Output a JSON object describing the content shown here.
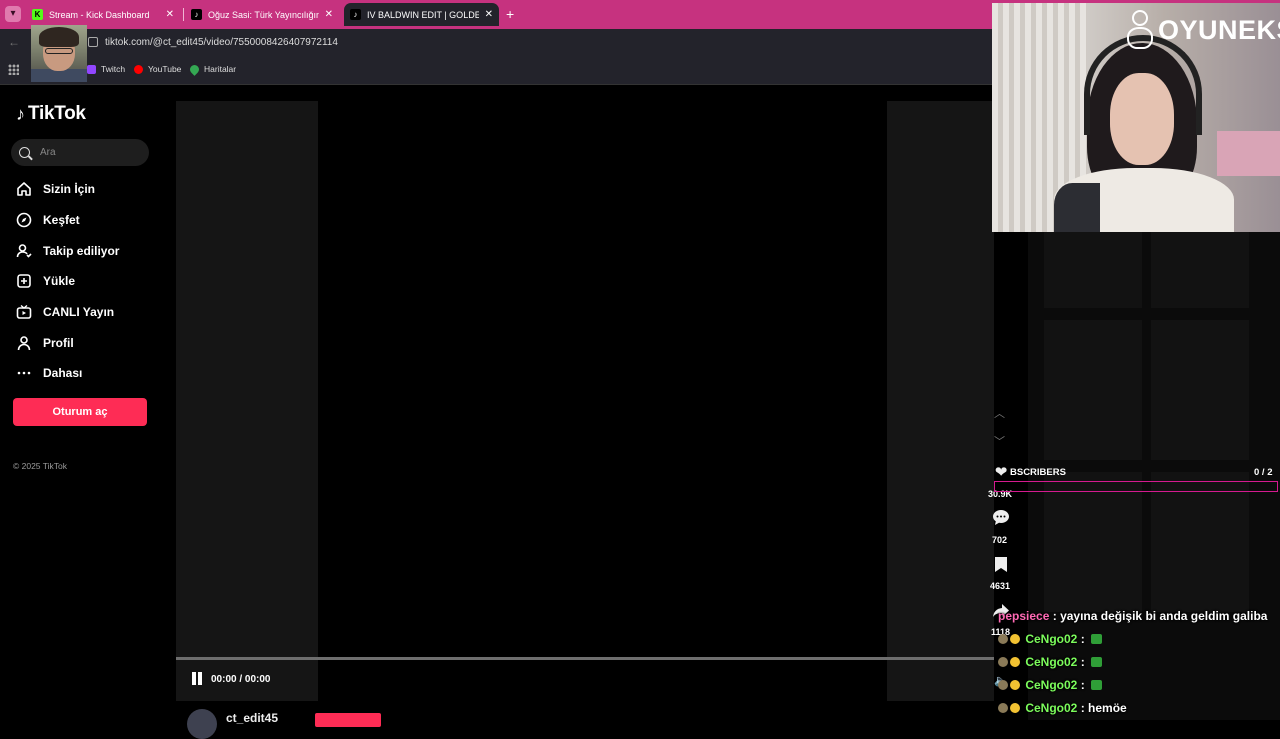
{
  "browser": {
    "tabs": [
      {
        "title": "Stream - Kick Dashboard",
        "favicon": "K",
        "favicon_color": "#53fc18",
        "active": false
      },
      {
        "title": "Oğuz Sasi: Türk Yayıncılığının G",
        "favicon": "♪",
        "favicon_color": "#000000",
        "active": false
      },
      {
        "title": "IV BALDWIN EDIT | GOLDEN BI",
        "favicon": "♪",
        "favicon_color": "#000000",
        "active": true
      }
    ],
    "new_tab_icon": "+",
    "url": "tiktok.com/@ct_edit45/video/7550008426407972114",
    "bookmarks": [
      {
        "label": "Twitch",
        "icon": "twitch-icon",
        "color": "#9146ff"
      },
      {
        "label": "YouTube",
        "icon": "youtube-icon",
        "color": "#ff0000"
      },
      {
        "label": "Haritalar",
        "icon": "maps-icon",
        "color": "#34a853"
      }
    ]
  },
  "tiktok": {
    "logo": "TikTok",
    "search_placeholder": "Ara",
    "nav": [
      {
        "label": "Sizin İçin",
        "icon": "home-icon"
      },
      {
        "label": "Keşfet",
        "icon": "compass-icon"
      },
      {
        "label": "Takip ediliyor",
        "icon": "following-icon"
      },
      {
        "label": "Yükle",
        "icon": "upload-icon"
      },
      {
        "label": "CANLI Yayın",
        "icon": "live-icon"
      },
      {
        "label": "Profil",
        "icon": "profile-icon"
      },
      {
        "label": "Dahası",
        "icon": "more-icon"
      }
    ],
    "login_button": "Oturum aç",
    "copyright": "© 2025 TikTok",
    "player": {
      "time": "00:00 / 00:00",
      "author": "ct_edit45"
    },
    "actions": {
      "likes": "30.9K",
      "comments": "702",
      "saves": "4631",
      "shares": "1118"
    },
    "accent_color": "#fe2c55"
  },
  "overlay": {
    "brand": "OYUNEKS",
    "subscribers_label": "BSCRIBERS",
    "subscribers_count": "0 / 2",
    "subscribers_progress": 0,
    "chat": [
      {
        "user": "pepsiece",
        "message": "yayına değişik bi anda geldim galiba",
        "color": "#ff69b4",
        "badges": false,
        "emote": false
      },
      {
        "user": "CeNgo02",
        "message": "",
        "color": "#7cfc5c",
        "badges": true,
        "emote": true
      },
      {
        "user": "CeNgo02",
        "message": "",
        "color": "#7cfc5c",
        "badges": true,
        "emote": true
      },
      {
        "user": "CeNgo02",
        "message": "",
        "color": "#7cfc5c",
        "badges": true,
        "emote": true
      },
      {
        "user": "CeNgo02",
        "message": "hemöe",
        "color": "#7cfc5c",
        "badges": true,
        "emote": false
      }
    ]
  }
}
